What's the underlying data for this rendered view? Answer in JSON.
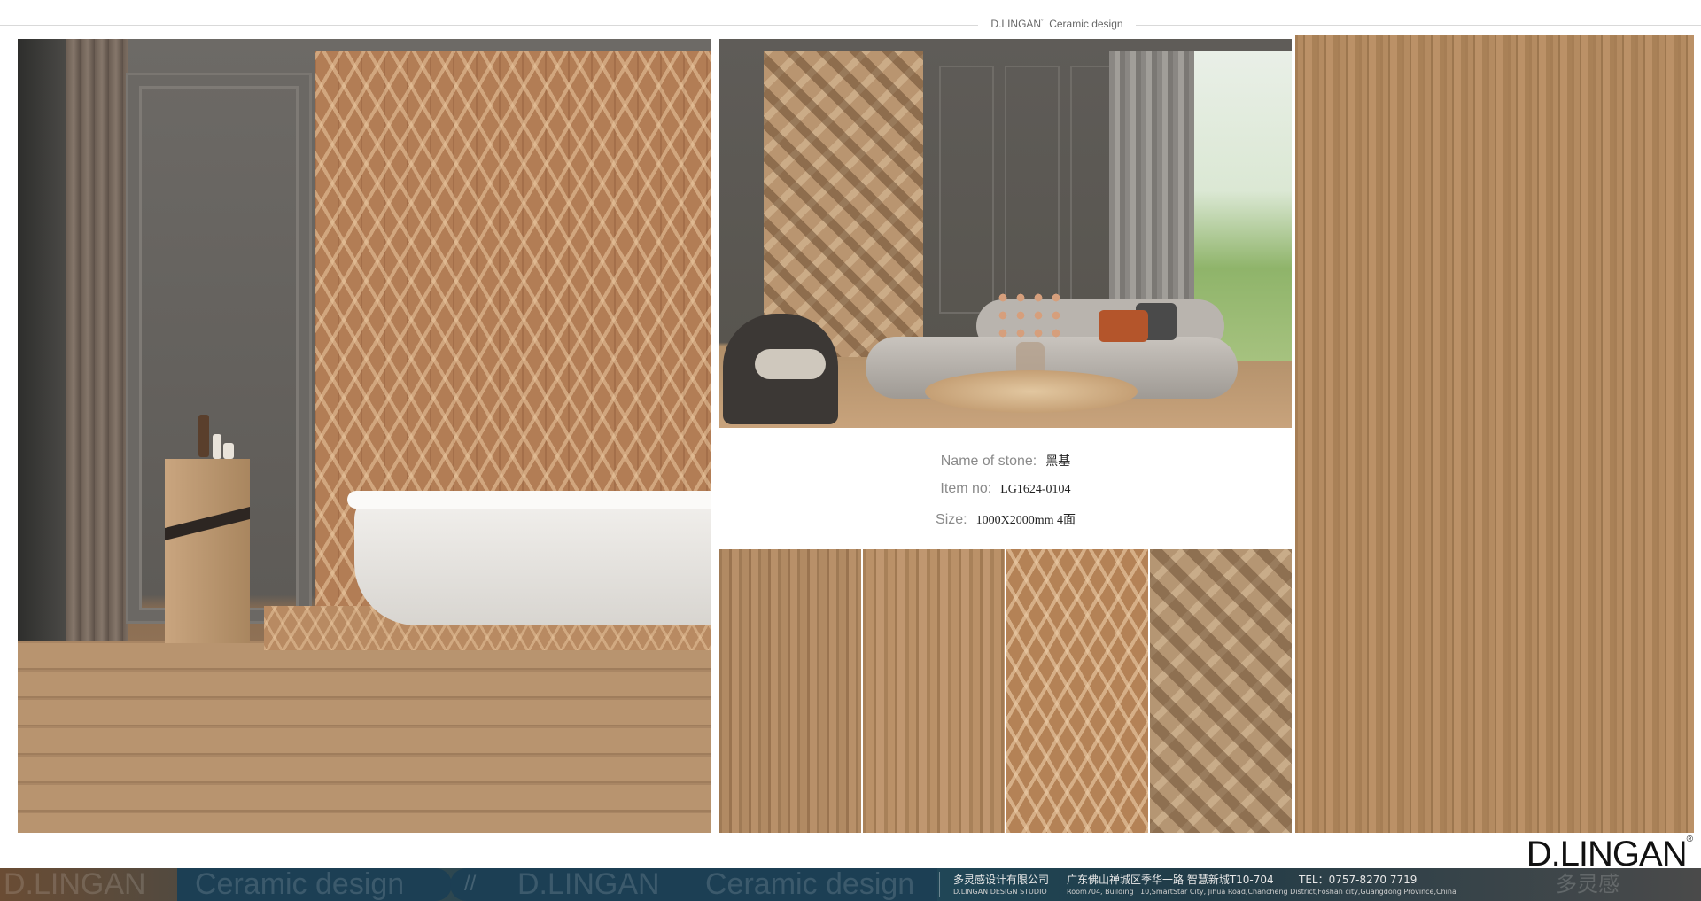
{
  "header": {
    "brand": "D.LINGAN",
    "registered_mark": "°",
    "subtitle": "Ceramic design"
  },
  "product_info": {
    "name_label": "Name of stone:",
    "name_value": "黑基",
    "item_label": "Item no:",
    "item_value": "LG1624-0104",
    "size_label": "Size:",
    "size_value": "1000X2000mm 4面"
  },
  "logo": {
    "text": "D.LINGAN",
    "registered_mark": "®"
  },
  "footer": {
    "watermark_brand": "D.LINGAN",
    "watermark_tagline": "Ceramic design",
    "watermark_cn": "多灵感",
    "company_cn": "多灵感设计有限公司",
    "studio_en": "D.LINGAN DESIGN STUDIO",
    "address_cn": "广东佛山禅城区季华一路 智慧新城T10-704",
    "tel": "TEL：0757-8270 7719",
    "address_en": "Room704, Building T10,SmartStar City, Jihua Road,Chancheng  District,Foshan  city,Guangdong Province,China"
  }
}
